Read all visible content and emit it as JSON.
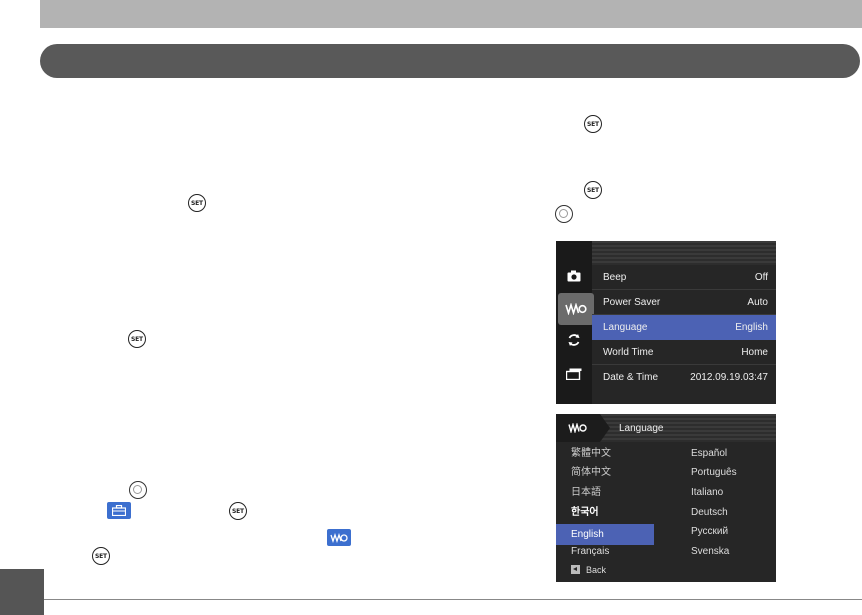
{
  "menu1": {
    "rows": [
      {
        "label": "Beep",
        "value": "Off"
      },
      {
        "label": "Power Saver",
        "value": "Auto"
      },
      {
        "label": "Language",
        "value": "English"
      },
      {
        "label": "World Time",
        "value": "Home"
      },
      {
        "label": "Date & Time",
        "value": "2012.09.19.03:47"
      }
    ]
  },
  "menu2": {
    "title": "Language",
    "left_col": [
      "繁體中文",
      "简体中文",
      "日本語",
      "한국어",
      "English",
      "Français"
    ],
    "right_col": [
      "Español",
      "Português",
      "Italiano",
      "Deutsch",
      "Русский",
      "Svenska"
    ],
    "back_label": "Back"
  },
  "buttons": {
    "set_label": "SET"
  },
  "icons": {
    "set": "set-button-icon",
    "dial": "dial-ring-icon",
    "toolbox": "toolbox-icon",
    "wrench": "wrench-setup-icon",
    "camera": "camera-icon",
    "refresh": "refresh-icon",
    "folder": "folder-icon"
  },
  "colors": {
    "highlight": "#4c62b4",
    "inline_icon_bg": "#3c6fcf"
  }
}
